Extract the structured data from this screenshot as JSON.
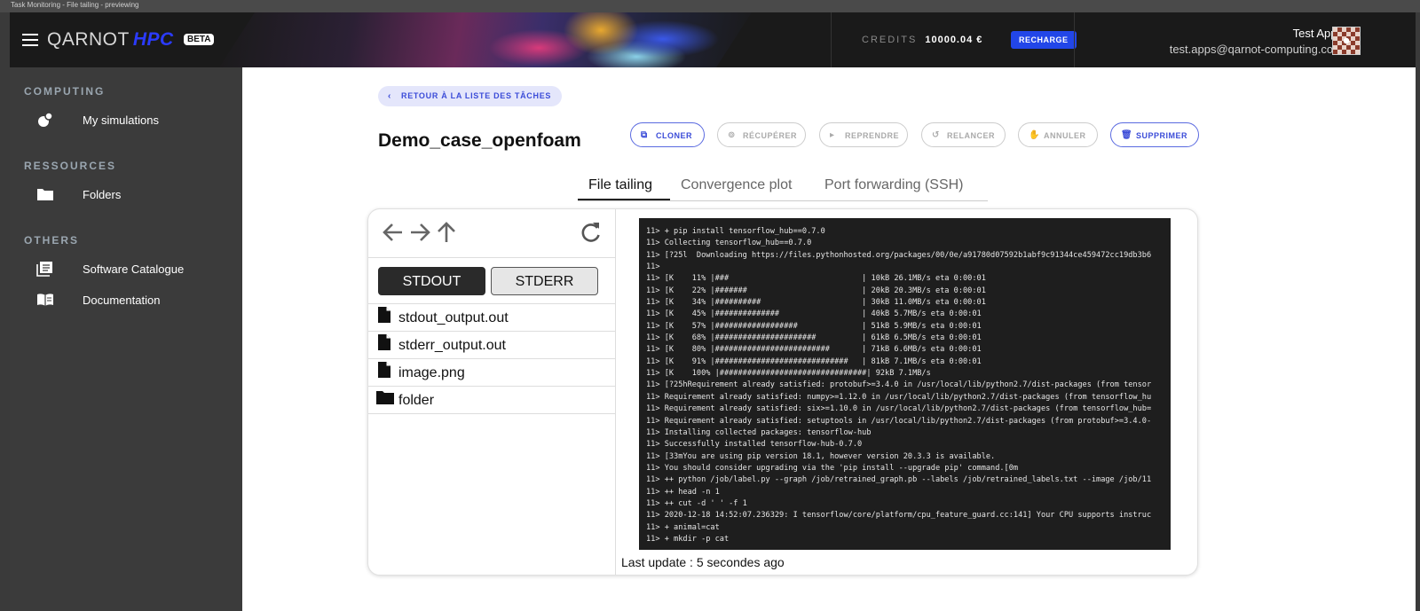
{
  "window": {
    "title": "Task Monitoring - File tailing - previewing"
  },
  "header": {
    "logo_text": "QARNOT",
    "logo_accent": "HPC",
    "beta": "BETA",
    "credits_label": "CREDITS",
    "credits_value": "10000.04 €",
    "recharge": "RECHARGE",
    "user_name": "Test Apps",
    "user_email": "test.apps@qarnot-computing.com"
  },
  "sidebar": {
    "sections": [
      "COMPUTING",
      "RESSOURCES",
      "OTHERS"
    ],
    "items": [
      {
        "label": "My simulations",
        "icon": "simulations-icon"
      },
      {
        "label": "Folders",
        "icon": "folder-icon"
      },
      {
        "label": "Software Catalogue",
        "icon": "catalogue-icon"
      },
      {
        "label": "Documentation",
        "icon": "book-icon"
      }
    ]
  },
  "task": {
    "back_label": "RETOUR À LA LISTE DES TÂCHES",
    "title": "Demo_case_openfoam",
    "actions": [
      {
        "label": "CLONER",
        "enabled": true
      },
      {
        "label": "RÉCUPÉRER",
        "enabled": false
      },
      {
        "label": "REPRENDRE",
        "enabled": false
      },
      {
        "label": "RELANCER",
        "enabled": false
      },
      {
        "label": "ANNULER",
        "enabled": false
      },
      {
        "label": "SUPPRIMER",
        "enabled": true
      }
    ]
  },
  "tabs": [
    "File tailing",
    "Convergence plot",
    "Port forwarding (SSH)"
  ],
  "files_pane": {
    "stdout": "STDOUT",
    "stderr": "STDERR",
    "files": [
      {
        "name": "stdout_output.out",
        "type": "file"
      },
      {
        "name": "stderr_output.out",
        "type": "file"
      },
      {
        "name": "image.png",
        "type": "file"
      },
      {
        "name": "folder",
        "type": "folder"
      }
    ]
  },
  "terminal": {
    "lines": [
      "11> + pip install tensorflow_hub==0.7.0",
      "11> Collecting tensorflow_hub==0.7.0",
      "11> [?25l  Downloading https://files.pythonhosted.org/packages/00/0e/a91780d07592b1abf9c91344ce459472cc19db3b6",
      "11>",
      "11> [K    11% |###                             | 10kB 26.1MB/s eta 0:00:01",
      "11> [K    22% |#######                         | 20kB 20.3MB/s eta 0:00:01",
      "11> [K    34% |##########                      | 30kB 11.0MB/s eta 0:00:01",
      "11> [K    45% |##############                  | 40kB 5.7MB/s eta 0:00:01",
      "11> [K    57% |##################              | 51kB 5.9MB/s eta 0:00:01",
      "11> [K    68% |######################          | 61kB 6.5MB/s eta 0:00:01",
      "11> [K    80% |#########################       | 71kB 6.6MB/s eta 0:00:01",
      "11> [K    91% |#############################   | 81kB 7.1MB/s eta 0:00:01",
      "11> [K    100% |################################| 92kB 7.1MB/s",
      "11> [?25hRequirement already satisfied: protobuf>=3.4.0 in /usr/local/lib/python2.7/dist-packages (from tensor",
      "11> Requirement already satisfied: numpy>=1.12.0 in /usr/local/lib/python2.7/dist-packages (from tensorflow_hu",
      "11> Requirement already satisfied: six>=1.10.0 in /usr/local/lib/python2.7/dist-packages (from tensorflow_hub=",
      "11> Requirement already satisfied: setuptools in /usr/local/lib/python2.7/dist-packages (from protobuf>=3.4.0-",
      "11> Installing collected packages: tensorflow-hub",
      "11> Successfully installed tensorflow-hub-0.7.0",
      "11> [33mYou are using pip version 18.1, however version 20.3.3 is available.",
      "11> You should consider upgrading via the 'pip install --upgrade pip' command.[0m",
      "11> ++ python /job/label.py --graph /job/retrained_graph.pb --labels /job/retrained_labels.txt --image /job/11",
      "11> ++ head -n 1",
      "11> ++ cut -d ' ' -f 1",
      "11> 2020-12-18 14:52:07.236329: I tensorflow/core/platform/cpu_feature_guard.cc:141] Your CPU supports instruc",
      "11> + animal=cat",
      "11> + mkdir -p cat"
    ]
  },
  "last_update": "Last update : 5 secondes ago",
  "colors": {
    "accent": "#2246e8",
    "sidebar_bg": "#3b3b3b",
    "topbar_bg": "#1a1a1a",
    "terminal_bg": "#1e1e1e"
  }
}
